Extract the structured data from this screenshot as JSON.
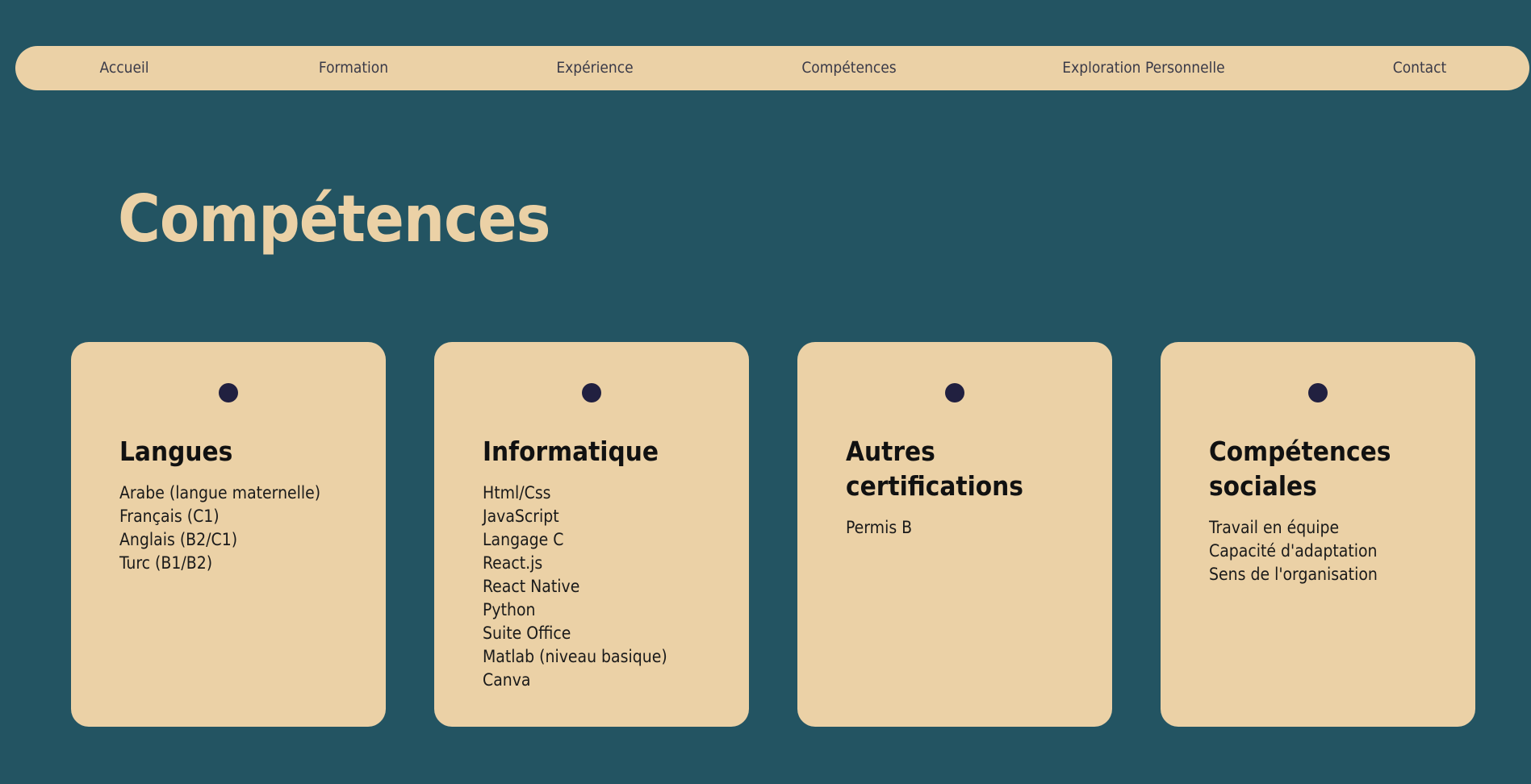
{
  "nav": {
    "items": [
      {
        "label": "Accueil"
      },
      {
        "label": "Formation"
      },
      {
        "label": "Expérience"
      },
      {
        "label": "Compétences"
      },
      {
        "label": "Exploration Personnelle"
      },
      {
        "label": "Contact"
      }
    ]
  },
  "page": {
    "title": "Compétences"
  },
  "cards": [
    {
      "title": "Langues",
      "items": [
        "Arabe (langue maternelle)",
        "Français (C1)",
        "Anglais (B2/C1)",
        "Turc (B1/B2)"
      ]
    },
    {
      "title": "Informatique",
      "items": [
        "Html/Css",
        "JavaScript",
        "Langage C",
        "React.js",
        "React Native",
        "Python",
        "Suite Office",
        "Matlab (niveau basique)",
        "Canva"
      ]
    },
    {
      "title": "Autres certifications",
      "items": [
        "Permis B"
      ]
    },
    {
      "title": "Compétences sociales",
      "items": [
        "Travail en équipe",
        "Capacité d'adaptation",
        "Sens de l'organisation"
      ]
    }
  ],
  "colors": {
    "background": "#235462",
    "accent": "#ebd1a6",
    "dot": "#212040"
  }
}
